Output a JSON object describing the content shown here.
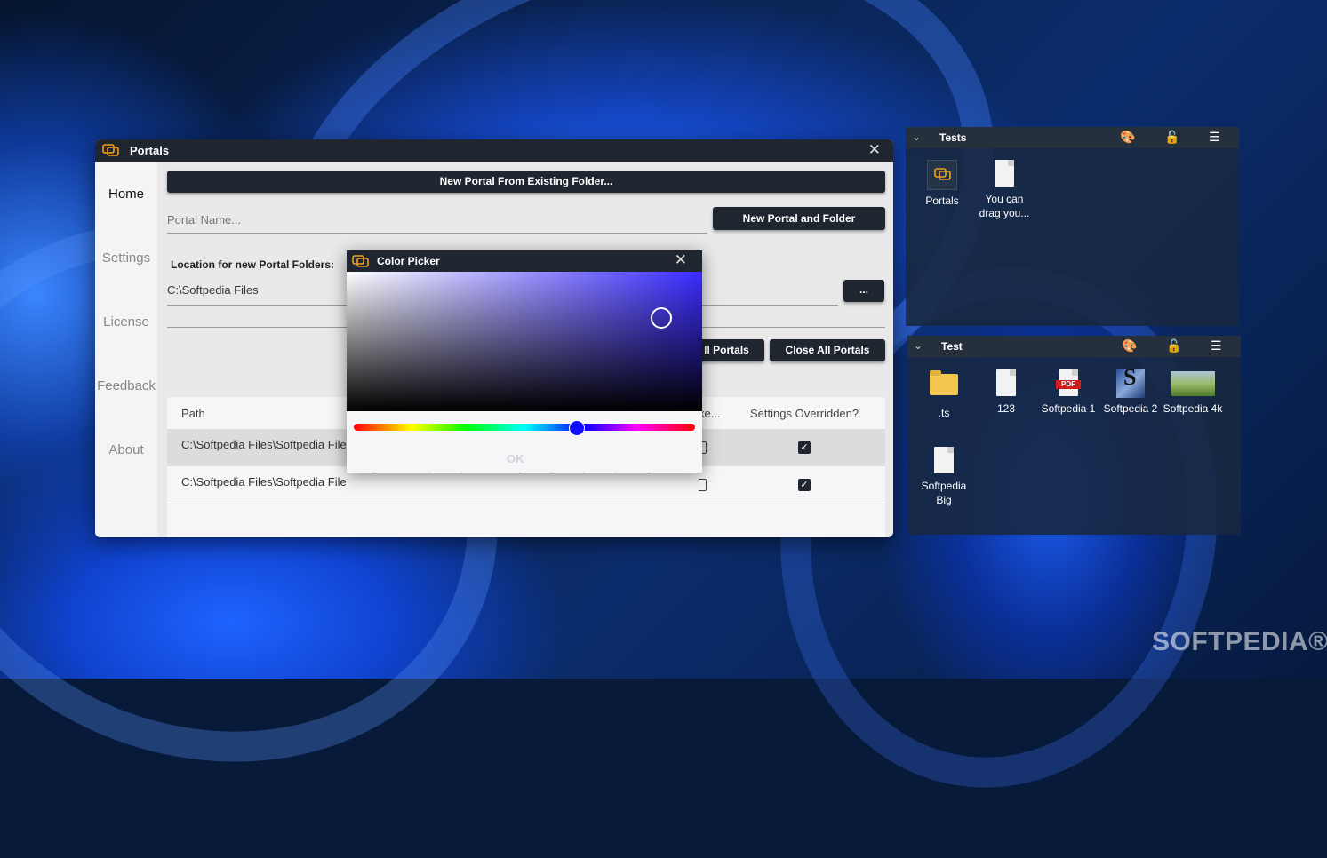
{
  "main_window": {
    "title": "Portals",
    "nav": [
      "Home",
      "Settings",
      "License",
      "Feedback",
      "About"
    ],
    "new_from_existing_label": "New Portal From Existing Folder...",
    "portal_name_placeholder": "Portal Name...",
    "new_portal_folder_label": "New Portal and Folder",
    "location_label": "Location for new Portal Folders:",
    "location_value": "C:\\Softpedia Files",
    "browse_label": "...",
    "open_all_partial": "ll Portals",
    "close_all_label": "Close All Portals",
    "table": {
      "col_path": "Path",
      "col_partial": "ke...",
      "col_overridden": "Settings Overridden?",
      "rows": [
        {
          "path": "C:\\Softpedia Files\\Softpedia File",
          "overridden": true
        },
        {
          "path": "C:\\Softpedia Files\\Softpedia File",
          "overridden": true
        }
      ]
    }
  },
  "color_picker": {
    "title": "Color Picker",
    "ok_label": "OK",
    "hue_color": "#3a2bff",
    "selected_color": "#1010ff"
  },
  "portals": [
    {
      "name": "Tests",
      "items": [
        {
          "label": "Portals",
          "icon": "portals-app-icon"
        },
        {
          "label": "You can drag you...",
          "icon": "document-icon"
        }
      ]
    },
    {
      "name": "Test",
      "items": [
        {
          "label": ".ts",
          "icon": "folder-icon"
        },
        {
          "label": "123",
          "icon": "document-icon"
        },
        {
          "label": "Softpedia 1",
          "icon": "pdf-icon"
        },
        {
          "label": "Softpedia 2",
          "icon": "image-icon"
        },
        {
          "label": "Softpedia 4k",
          "icon": "photo-icon"
        },
        {
          "label": "Softpedia Big",
          "icon": "document-icon"
        }
      ]
    }
  ],
  "watermark": "SOFTPEDIA®",
  "pdf_badge": "PDF",
  "s_logo": "S"
}
